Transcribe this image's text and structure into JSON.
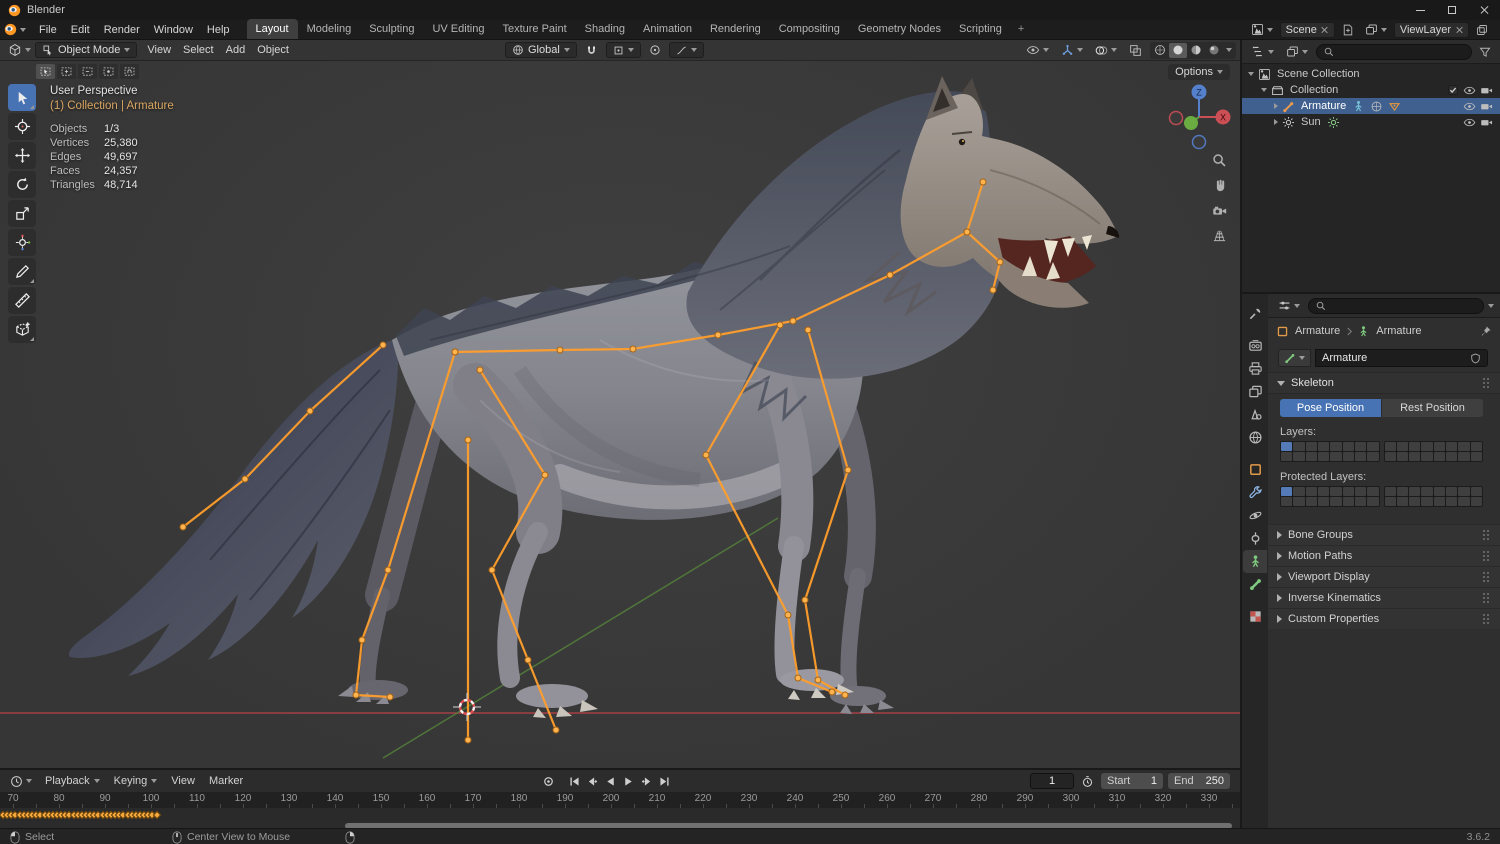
{
  "titlebar": {
    "title": "Blender"
  },
  "topbar": {
    "menus": [
      "File",
      "Edit",
      "Render",
      "Window",
      "Help"
    ],
    "workspaces": [
      "Layout",
      "Modeling",
      "Sculpting",
      "UV Editing",
      "Texture Paint",
      "Shading",
      "Animation",
      "Rendering",
      "Compositing",
      "Geometry Nodes",
      "Scripting"
    ],
    "active_workspace": "Layout",
    "add_tab": "+",
    "scene_name": "Scene",
    "viewlayer_name": "ViewLayer"
  },
  "viewport": {
    "header": {
      "mode": "Object Mode",
      "menus": [
        "View",
        "Select",
        "Add",
        "Object"
      ],
      "orientation": "Global",
      "options_label": "Options"
    },
    "overlay": {
      "view_name": "User Perspective",
      "context": "(1) Collection | Armature",
      "stats": [
        {
          "label": "Objects",
          "value": "1/3"
        },
        {
          "label": "Vertices",
          "value": "25,380"
        },
        {
          "label": "Edges",
          "value": "49,697"
        },
        {
          "label": "Faces",
          "value": "24,357"
        },
        {
          "label": "Triangles",
          "value": "48,714"
        }
      ]
    },
    "gizmo": {
      "z": "Z",
      "x": "X"
    }
  },
  "outliner": {
    "rows": [
      {
        "label": "Scene Collection",
        "depth": 0,
        "icon": "scene",
        "expanded": true,
        "selected": false,
        "inline_icons": [],
        "right_icons": []
      },
      {
        "label": "Collection",
        "depth": 1,
        "icon": "collection",
        "expanded": true,
        "selected": false,
        "inline_icons": [],
        "right_icons": [
          "checkbox",
          "eye",
          "camera"
        ]
      },
      {
        "label": "Armature",
        "depth": 2,
        "icon": "armature",
        "expanded": false,
        "selected": true,
        "inline_icons": [
          "pose",
          "mesh",
          "triangle"
        ],
        "right_icons": [
          "eye",
          "camera"
        ]
      },
      {
        "label": "Sun",
        "depth": 2,
        "icon": "sun",
        "expanded": false,
        "selected": false,
        "inline_icons": [
          "sundata"
        ],
        "right_icons": [
          "eye",
          "camera"
        ]
      }
    ]
  },
  "properties": {
    "tabs": [
      "tool",
      "render",
      "output",
      "viewlayer",
      "scene",
      "world",
      "object",
      "modifiers",
      "physics",
      "constraints",
      "data",
      "bone",
      "texture"
    ],
    "active_tab": "data",
    "breadcrumb": {
      "object": "Armature",
      "data": "Armature"
    },
    "name_value": "Armature",
    "skeleton": {
      "title": "Skeleton",
      "pose": "Pose Position",
      "rest": "Rest Position",
      "active": "Pose Position",
      "layers_label": "Layers:",
      "protected_label": "Protected Layers:"
    },
    "collapsed_panels": [
      "Bone Groups",
      "Motion Paths",
      "Viewport Display",
      "Inverse Kinematics",
      "Custom Properties"
    ]
  },
  "timeline": {
    "menus": [
      {
        "label": "Playback",
        "chevron": true
      },
      {
        "label": "Keying",
        "chevron": true
      },
      {
        "label": "View",
        "chevron": false
      },
      {
        "label": "Marker",
        "chevron": false
      }
    ],
    "current_frame": "1",
    "start_label": "Start",
    "start_value": "1",
    "end_label": "End",
    "end_value": "250",
    "ticks": [
      "70",
      "80",
      "90",
      "100",
      "110",
      "120",
      "130",
      "140",
      "150",
      "160",
      "170",
      "180",
      "190",
      "200",
      "210",
      "220",
      "230",
      "240",
      "250",
      "260",
      "270",
      "280",
      "290",
      "300",
      "310",
      "320",
      "330"
    ],
    "keyframe_count": 38
  },
  "statusbar": {
    "select_label": "Select",
    "center_label": "Center View to Mouse",
    "version": "3.6.2"
  }
}
